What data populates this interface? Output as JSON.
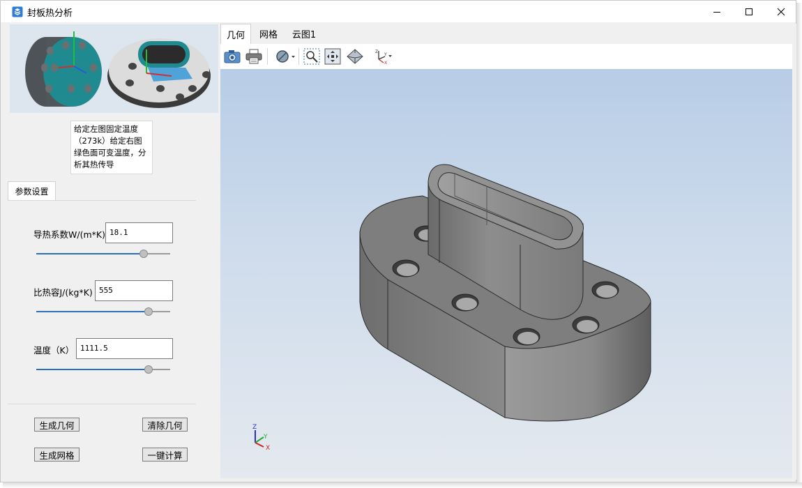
{
  "window": {
    "title": "封板热分析",
    "icon": "app-icon",
    "controls": [
      "minimize-icon",
      "maximize-icon",
      "close-icon"
    ]
  },
  "left_panel": {
    "description": "给定左图固定温度（273k）给定右图绿色面可变温度，分析其热传导",
    "tab_label": "参数设置",
    "params": {
      "conductivity": {
        "label": "导热系数W/(m*K)",
        "value": "18.1",
        "slider_level": 0.82
      },
      "specific_heat": {
        "label": "比热容J/(kg*K)",
        "value": "555",
        "slider_level": 0.86
      },
      "temperature": {
        "label": "温度（K）",
        "value": "1111.5",
        "slider_level": 0.86
      }
    },
    "buttons": {
      "generate_geometry": "生成几何",
      "clear_geometry": "清除几何",
      "generate_mesh": "生成网格",
      "one_click_compute": "一键计算"
    }
  },
  "right_panel": {
    "tabs": [
      {
        "label": "几何",
        "active": true
      },
      {
        "label": "网格",
        "active": false
      },
      {
        "label": "云图1",
        "active": false
      }
    ],
    "toolbar_icons": [
      "camera-icon",
      "printer-icon",
      "display-mode-icon",
      "zoom-area-icon",
      "fit-all-icon",
      "view-orientation-icon",
      "axes-triad-icon"
    ],
    "axis_labels": {
      "x": "X",
      "y": "Y",
      "z": "Z"
    }
  },
  "colors": {
    "accent": "#2a6fbe",
    "teal_face": "#1f8a8f",
    "model_gray": "#8a8a8a",
    "viewport_top": "#b7cde6",
    "viewport_bottom": "#e4e9ef"
  }
}
